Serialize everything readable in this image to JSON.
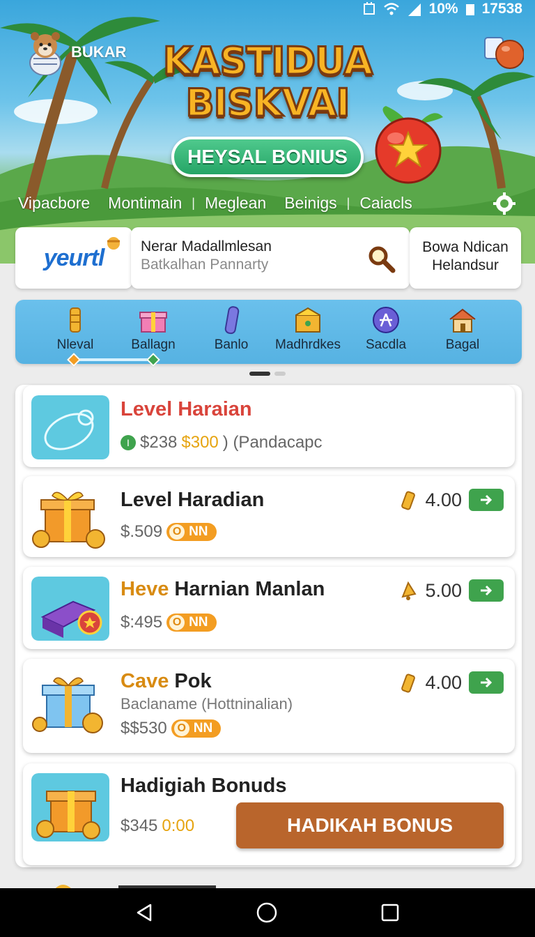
{
  "status_bar": {
    "battery": "10%",
    "time": "17538"
  },
  "hero": {
    "user_name": "BUKAR",
    "title_line1": "KASTIDUA",
    "title_line2": "BISKVAI",
    "badge": "HEYSAL BONIUS",
    "nav": [
      "Vipacbore",
      "Montimain",
      "Meglean",
      "Beinigs",
      "Caiacls"
    ]
  },
  "search": {
    "brand": "yeurtl",
    "title": "Nerar Madallmlesan",
    "placeholder": "Batkalhan Pannarty",
    "promo_line1": "Bowa Ndican",
    "promo_line2": "Helandsur"
  },
  "categories": [
    {
      "label": "Nleval",
      "icon": "coin-stack-icon"
    },
    {
      "label": "Ballagn",
      "icon": "gift-icon"
    },
    {
      "label": "Banlo",
      "icon": "tube-icon"
    },
    {
      "label": "Madhrdkes",
      "icon": "treasure-icon"
    },
    {
      "label": "Sacdla",
      "icon": "badge-icon"
    },
    {
      "label": "Bagal",
      "icon": "house-icon"
    }
  ],
  "list": [
    {
      "title": "Level Haraian",
      "price_prefix": "I",
      "price_main": "$238",
      "price_accent": "$300",
      "price_tail": ") (Pandacapc"
    },
    {
      "title": "Level Haradian",
      "price": "$.509",
      "pill": "NN",
      "value": "4.00"
    },
    {
      "title_accent": "Heve",
      "title_rest": "Harnian Manlan",
      "price": "$:495",
      "pill": "NN",
      "value": "5.00"
    },
    {
      "title_accent": "Cave",
      "title_rest": "Pok",
      "subtitle": "Baclaname (Hottninalian)",
      "price": "$$530",
      "pill": "NN",
      "value": "4.00"
    },
    {
      "title": "Hadigiah Bonuds",
      "price": "$345",
      "price_accent": "0:00",
      "button": "HADIKAH BONUS"
    }
  ],
  "colors": {
    "accent_green": "#3fa34d",
    "accent_orange": "#f39d22",
    "bonus_button": "#b9652c",
    "title_red": "#d9443b"
  }
}
